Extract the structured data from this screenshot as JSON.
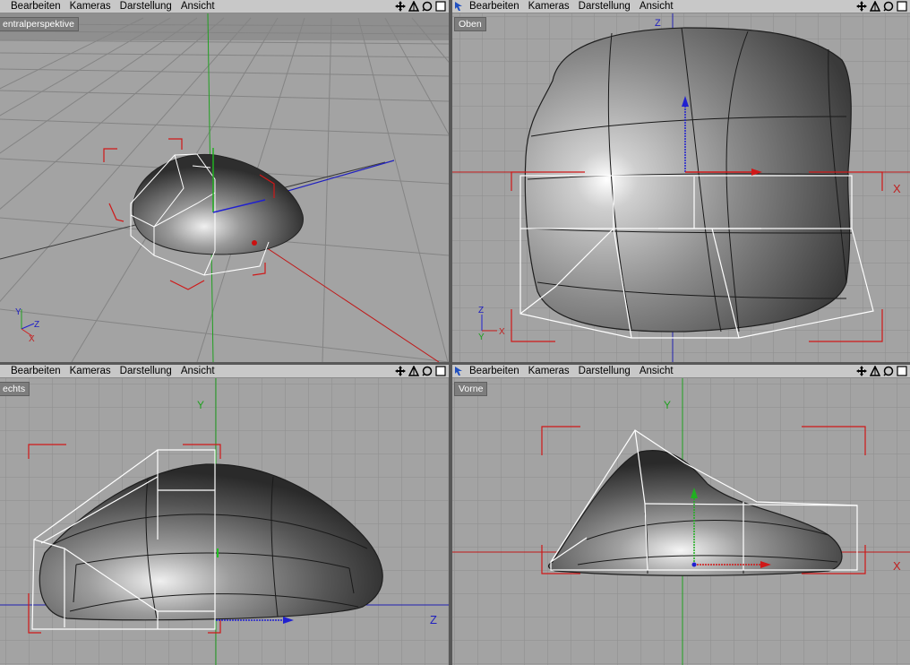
{
  "menu": {
    "items": [
      "Bearbeiten",
      "Kameras",
      "Darstellung",
      "Ansicht"
    ]
  },
  "viewports": {
    "perspective": {
      "label": "entralperspektive"
    },
    "top": {
      "label": "Oben"
    },
    "right": {
      "label": "echts"
    },
    "front": {
      "label": "Vorne"
    }
  },
  "axes": {
    "x": "X",
    "y": "Y",
    "z": "Z"
  },
  "colors": {
    "menubar": "#c8c8c8",
    "grid": "#8c8c8c",
    "axis_red": "#c81414",
    "axis_green": "#14a014",
    "axis_blue": "#1a1ad0",
    "selection": "#ffffff"
  },
  "icons": [
    "move-icon",
    "rotate-icon",
    "zoom-icon",
    "maximize-icon"
  ]
}
